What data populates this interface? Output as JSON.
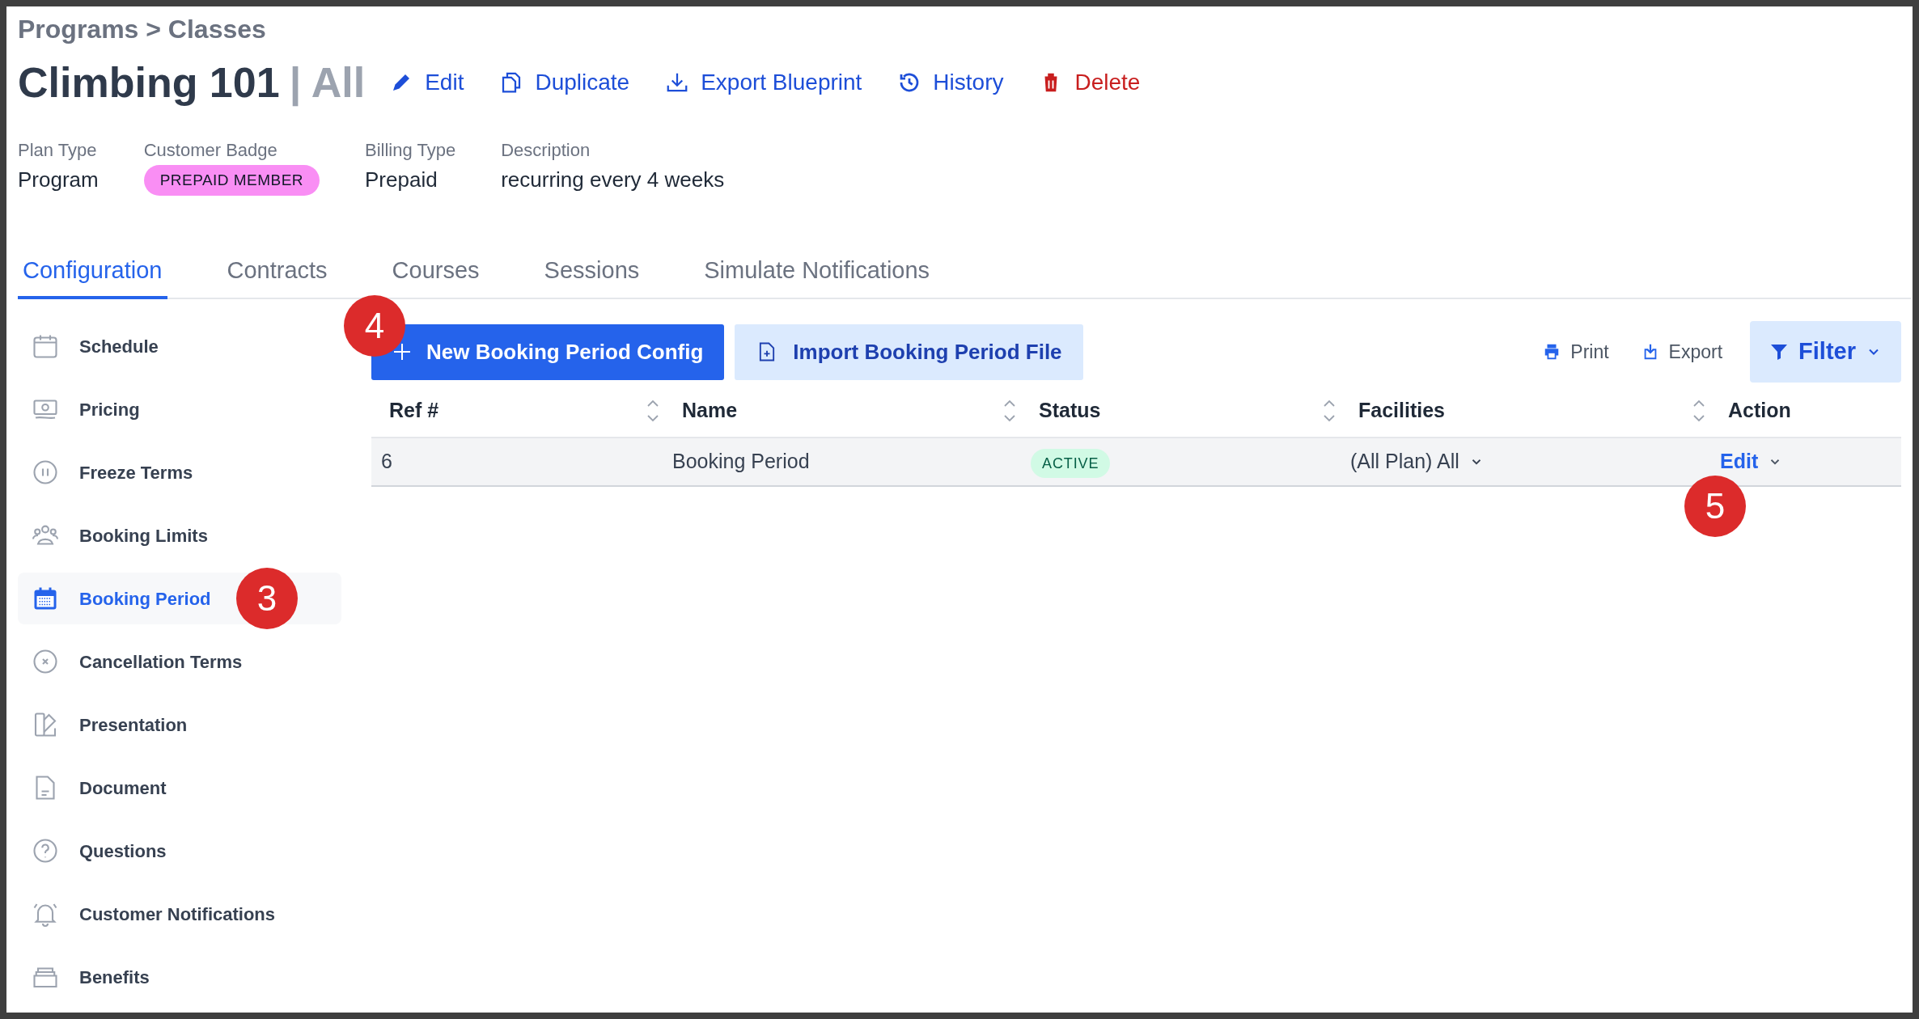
{
  "breadcrumb": "Programs > Classes",
  "title": {
    "name": "Climbing 101",
    "scope": "| All"
  },
  "actions": [
    {
      "label": "Edit",
      "kind": "normal"
    },
    {
      "label": "Duplicate",
      "kind": "normal"
    },
    {
      "label": "Export Blueprint",
      "kind": "normal"
    },
    {
      "label": "History",
      "kind": "normal"
    },
    {
      "label": "Delete",
      "kind": "danger"
    }
  ],
  "details": [
    {
      "label": "Plan Type",
      "value": "Program",
      "kind": "text"
    },
    {
      "label": "Customer Badge",
      "value": "PREPAID MEMBER",
      "kind": "badge",
      "color": "#f98ef4"
    },
    {
      "label": "Billing Type",
      "value": "Prepaid",
      "kind": "text"
    },
    {
      "label": "Description",
      "value": "recurring every 4 weeks",
      "kind": "text"
    }
  ],
  "tabs": [
    {
      "label": "Configuration",
      "selected": true
    },
    {
      "label": "Contracts",
      "selected": false
    },
    {
      "label": "Courses",
      "selected": false
    },
    {
      "label": "Sessions",
      "selected": false
    },
    {
      "label": "Simulate Notifications",
      "selected": false
    }
  ],
  "sidebar": {
    "items": [
      {
        "label": "Schedule",
        "selected": false
      },
      {
        "label": "Pricing",
        "selected": false
      },
      {
        "label": "Freeze Terms",
        "selected": false
      },
      {
        "label": "Booking Limits",
        "selected": false
      },
      {
        "label": "Booking Period",
        "selected": true,
        "marker": "3"
      },
      {
        "label": "Cancellation Terms",
        "selected": false
      },
      {
        "label": "Presentation",
        "selected": false
      },
      {
        "label": "Document",
        "selected": false
      },
      {
        "label": "Questions",
        "selected": false
      },
      {
        "label": "Customer Notifications",
        "selected": false
      },
      {
        "label": "Benefits",
        "selected": false
      }
    ]
  },
  "toolbar": {
    "buttons": [
      {
        "label": "New Booking Period Config",
        "kind": "primary",
        "marker": "4"
      },
      {
        "label": "Import Booking Period File",
        "kind": "secondary"
      }
    ],
    "links": [
      "Print",
      "Export"
    ],
    "filter": "Filter"
  },
  "table": {
    "columns": [
      {
        "label": "Ref #",
        "sortable": true
      },
      {
        "label": "Name",
        "sortable": true
      },
      {
        "label": "Status",
        "sortable": true
      },
      {
        "label": "Facilities",
        "sortable": true
      },
      {
        "label": "Action",
        "sortable": false
      }
    ],
    "rows": [
      {
        "ref": "6",
        "name": "Booking Period",
        "status": "ACTIVE",
        "facilities": "(All Plan) All",
        "action": "Edit",
        "action_marker": "5"
      }
    ]
  }
}
